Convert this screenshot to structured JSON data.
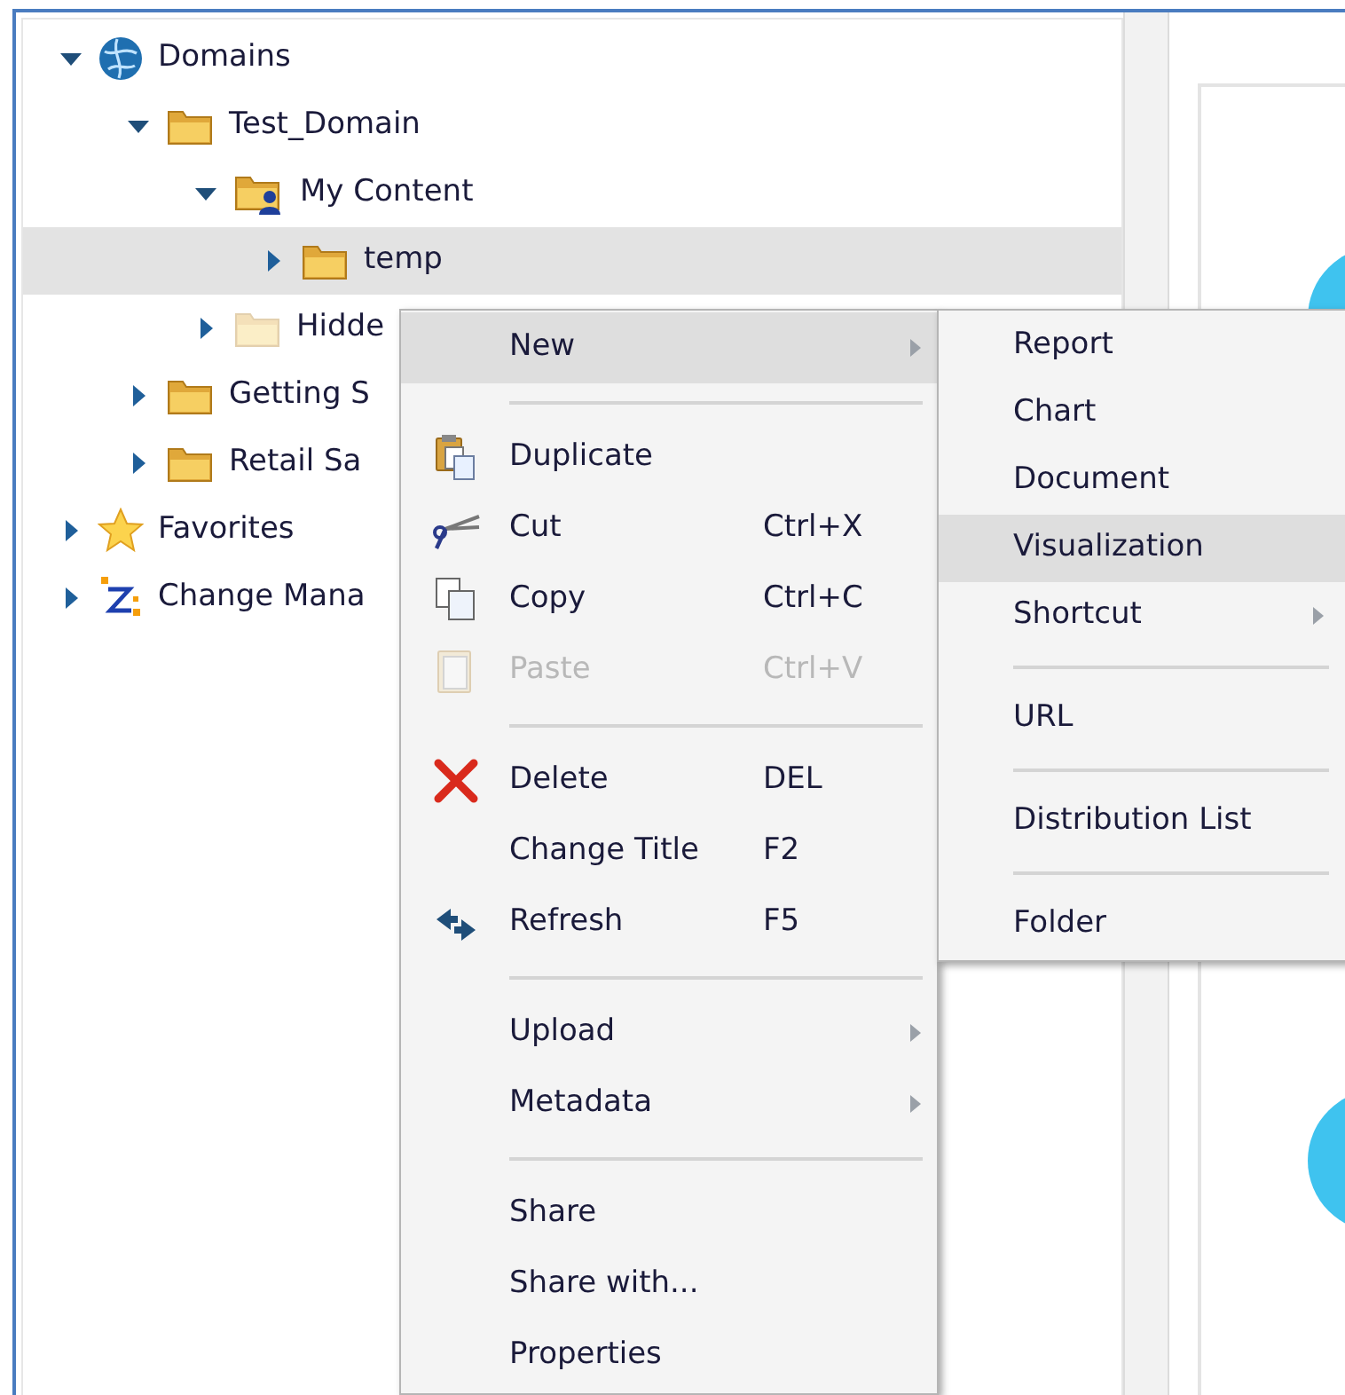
{
  "tree": {
    "items": [
      {
        "label": "Domains",
        "kind": "globe",
        "expanded": true,
        "selected": false,
        "children": [
          {
            "label": "Test_Domain",
            "kind": "folder",
            "expanded": true,
            "selected": false,
            "children": [
              {
                "label": "My Content",
                "kind": "user-folder",
                "expanded": true,
                "selected": false,
                "children": [
                  {
                    "label": "temp",
                    "kind": "folder",
                    "expanded": false,
                    "selected": true
                  }
                ]
              },
              {
                "label": "Hidde",
                "kind": "faded-folder",
                "expanded": false,
                "selected": false
              }
            ]
          },
          {
            "label": "Getting S",
            "kind": "folder",
            "expanded": false,
            "selected": false
          },
          {
            "label": "Retail Sa",
            "kind": "folder",
            "expanded": false,
            "selected": false
          }
        ]
      },
      {
        "label": "Favorites",
        "kind": "star",
        "expanded": false,
        "selected": false
      },
      {
        "label": "Change Mana",
        "kind": "change",
        "expanded": false,
        "selected": false
      }
    ]
  },
  "context_menu": {
    "items": [
      {
        "kind": "item",
        "label": "New",
        "submenu": true,
        "selected": true,
        "disabled": false
      },
      {
        "kind": "separator"
      },
      {
        "kind": "duplicate",
        "label": "Duplicate",
        "submenu": false,
        "selected": false,
        "disabled": false
      },
      {
        "kind": "cut",
        "label": "Cut",
        "shortcut": "Ctrl+X",
        "submenu": false,
        "selected": false,
        "disabled": false
      },
      {
        "kind": "copy",
        "label": "Copy",
        "shortcut": "Ctrl+C",
        "submenu": false,
        "selected": false,
        "disabled": false
      },
      {
        "kind": "paste",
        "label": "Paste",
        "shortcut": "Ctrl+V",
        "submenu": false,
        "selected": false,
        "disabled": true
      },
      {
        "kind": "separator"
      },
      {
        "kind": "delete",
        "label": "Delete",
        "shortcut": "DEL",
        "submenu": false,
        "selected": false,
        "disabled": false
      },
      {
        "kind": "item",
        "label": "Change Title",
        "shortcut": "F2",
        "submenu": false,
        "selected": false,
        "disabled": false
      },
      {
        "kind": "refresh",
        "label": "Refresh",
        "shortcut": "F5",
        "submenu": false,
        "selected": false,
        "disabled": false
      },
      {
        "kind": "separator"
      },
      {
        "kind": "item",
        "label": "Upload",
        "submenu": true,
        "selected": false,
        "disabled": false
      },
      {
        "kind": "item",
        "label": "Metadata",
        "submenu": true,
        "selected": false,
        "disabled": false
      },
      {
        "kind": "separator"
      },
      {
        "kind": "item",
        "label": "Share",
        "submenu": false,
        "selected": false,
        "disabled": false
      },
      {
        "kind": "item",
        "label": "Share with...",
        "submenu": false,
        "selected": false,
        "disabled": false
      },
      {
        "kind": "item",
        "label": "Properties",
        "submenu": false,
        "selected": false,
        "disabled": false
      }
    ]
  },
  "submenu": {
    "items": [
      {
        "kind": "item",
        "label": "Report",
        "submenu": false,
        "selected": false
      },
      {
        "kind": "item",
        "label": "Chart",
        "submenu": false,
        "selected": false
      },
      {
        "kind": "item",
        "label": "Document",
        "submenu": false,
        "selected": false
      },
      {
        "kind": "item",
        "label": "Visualization",
        "submenu": false,
        "selected": true
      },
      {
        "kind": "item",
        "label": "Shortcut",
        "submenu": true,
        "selected": false
      },
      {
        "kind": "separator"
      },
      {
        "kind": "item",
        "label": "URL",
        "submenu": false,
        "selected": false
      },
      {
        "kind": "separator"
      },
      {
        "kind": "item",
        "label": "Distribution List",
        "submenu": false,
        "selected": false
      },
      {
        "kind": "separator"
      },
      {
        "kind": "item",
        "label": "Folder",
        "submenu": false,
        "selected": false
      }
    ]
  }
}
